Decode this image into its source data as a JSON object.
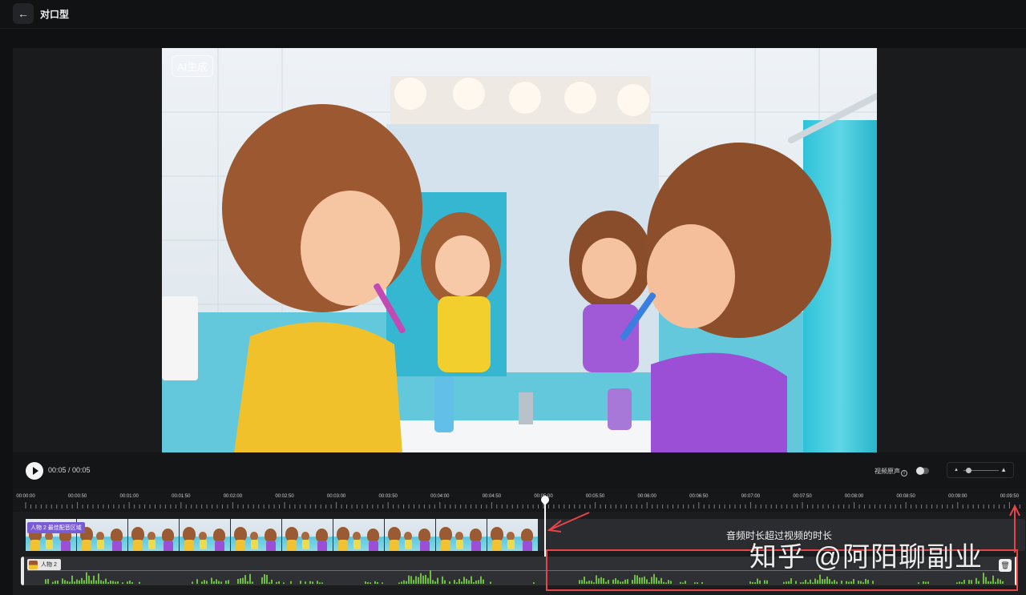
{
  "header": {
    "back_icon": "arrow-left-icon",
    "title": "对口型"
  },
  "preview": {
    "ai_badge": "AI生成"
  },
  "controls": {
    "play_icon": "play-icon",
    "time_readout": "00:05 / 00:05",
    "original_sound_label": "视频原声",
    "original_sound_on": false,
    "zoom_level": 0.15
  },
  "timeline": {
    "ruler_labels": [
      "00:00:00",
      "00:00:50",
      "00:01:00",
      "00:01:50",
      "00:02:00",
      "00:02:50",
      "00:03:00",
      "00:03:50",
      "00:04:00",
      "00:04:50",
      "00:05:00",
      "00:05:50",
      "00:06:00",
      "00:06:50",
      "00:07:00",
      "00:07:50",
      "00:08:00",
      "00:08:50",
      "00:09:00",
      "00:09:50"
    ],
    "video_clip_label": "人物 2 最佳配音区域",
    "audio_clip_label": "人物 2",
    "trash_icon": "trash-icon"
  },
  "annotation": {
    "notice": "音频时长超过视频的时长",
    "highlight_color": "#e8454a"
  },
  "watermark": {
    "text": "知乎 @阿阳聊副业"
  },
  "colors": {
    "accent_purple": "#7a5bd6",
    "waveform_green": "#6fbf3f",
    "annotation_red": "#e8454a"
  }
}
